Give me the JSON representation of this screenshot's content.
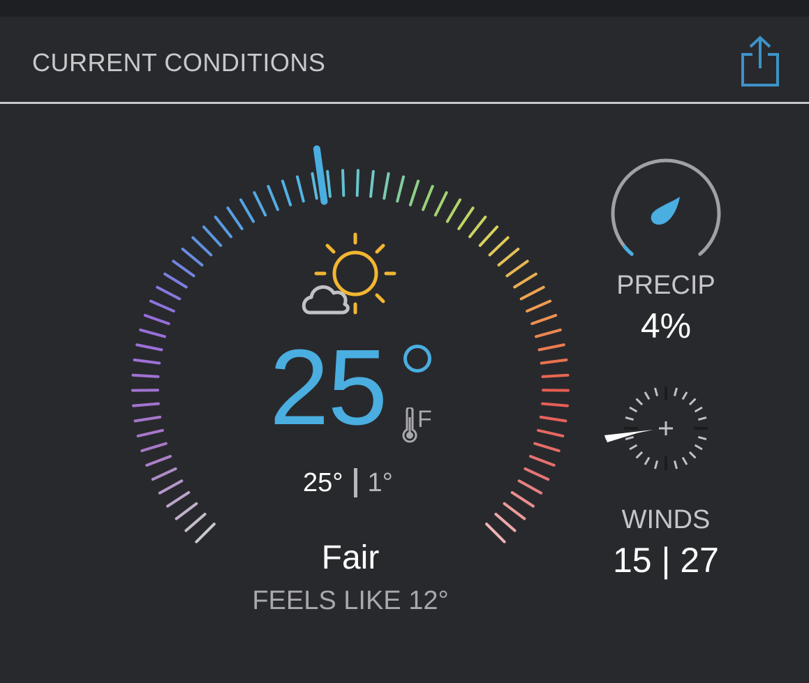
{
  "header": {
    "title": "CURRENT CONDITIONS",
    "share_icon": "share-icon"
  },
  "current": {
    "temperature": "25",
    "degree_symbol": "°",
    "unit": "F",
    "high": "25°",
    "low": "1°",
    "condition": "Fair",
    "feels_like": "FEELS LIKE 12°",
    "weather_icon": "partly-sunny-icon"
  },
  "precip": {
    "label": "PRECIP",
    "value": "4%",
    "fraction": 0.04,
    "icon": "raindrop-icon"
  },
  "winds": {
    "label": "WINDS",
    "value": "15 | 27",
    "direction_icon": "wind-arrow-icon"
  },
  "colors": {
    "accent": "#4aaee0",
    "background": "#28292d"
  }
}
